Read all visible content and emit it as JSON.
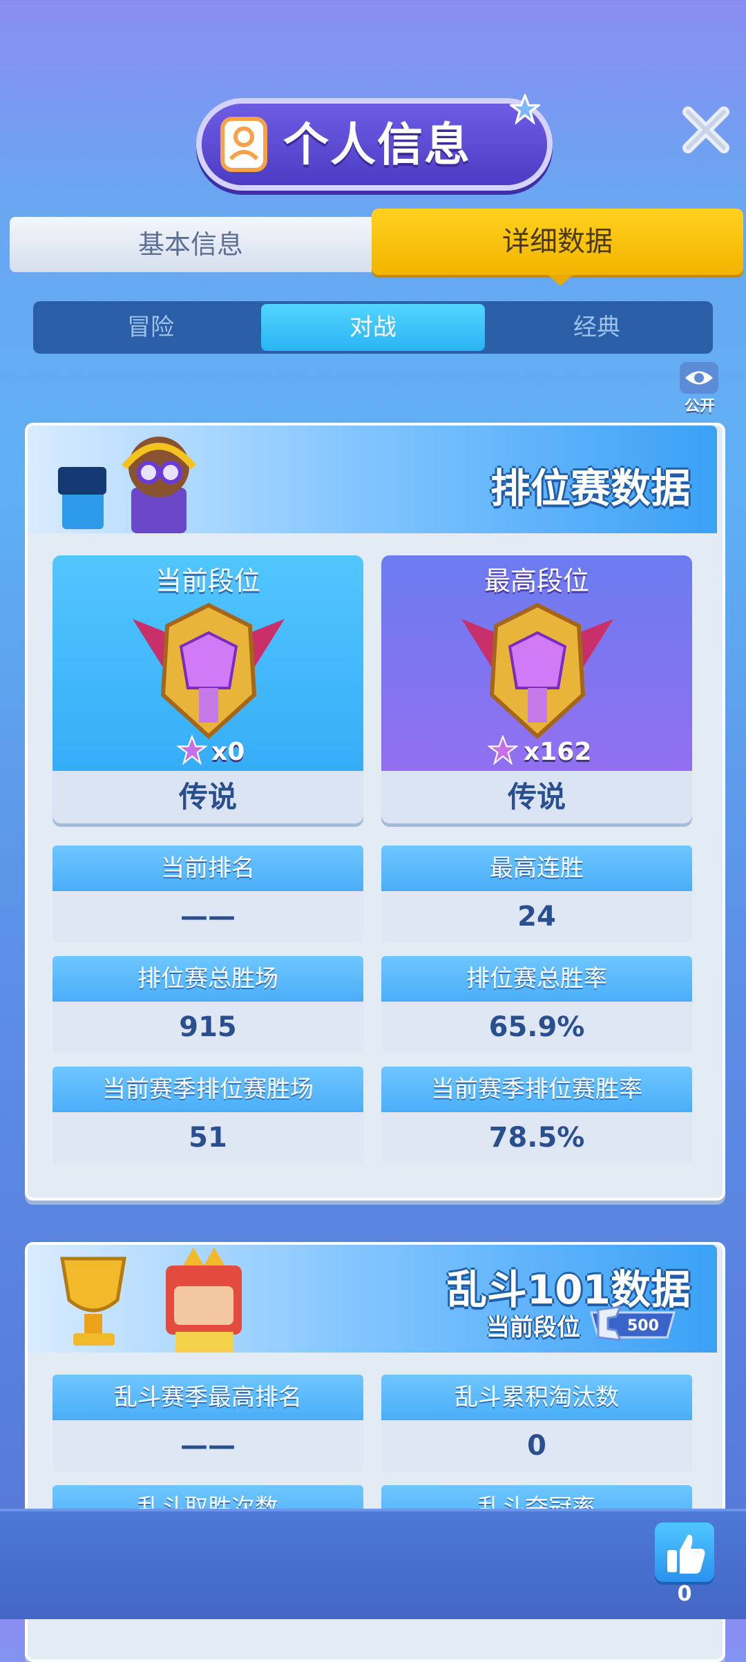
{
  "header": {
    "title": "个人信息"
  },
  "tabs": [
    {
      "label": "基本信息",
      "active": false
    },
    {
      "label": "详细数据",
      "active": true
    }
  ],
  "segments": [
    {
      "label": "冒险",
      "active": false
    },
    {
      "label": "对战",
      "active": true
    },
    {
      "label": "经典",
      "active": false
    }
  ],
  "public_toggle": {
    "label": "公开",
    "icon": "eye-icon"
  },
  "ranked": {
    "title": "排位赛数据",
    "current_tier": {
      "label": "当前段位",
      "stars": "x0",
      "name": "传说"
    },
    "highest_tier": {
      "label": "最高段位",
      "stars": "x162",
      "name": "传说"
    },
    "stats": [
      {
        "label": "当前排名",
        "value": "——"
      },
      {
        "label": "最高连胜",
        "value": "24"
      },
      {
        "label": "排位赛总胜场",
        "value": "915"
      },
      {
        "label": "排位赛总胜率",
        "value": "65.9%"
      },
      {
        "label": "当前赛季排位赛胜场",
        "value": "51"
      },
      {
        "label": "当前赛季排位赛胜率",
        "value": "78.5%"
      }
    ]
  },
  "brawl": {
    "title": "乱斗101数据",
    "current_tier_label": "当前段位",
    "tier_badge_value": "500",
    "stats": [
      {
        "label": "乱斗赛季最高排名",
        "value": "——"
      },
      {
        "label": "乱斗累积淘汰数",
        "value": "0"
      },
      {
        "label": "乱斗取胜次数",
        "value": ""
      },
      {
        "label": "乱斗夺冠率",
        "value": ""
      }
    ]
  },
  "likes": {
    "count": "0",
    "icon": "thumbs-up-icon"
  },
  "colors": {
    "accent_yellow": "#f2b400",
    "accent_blue": "#28b4f3",
    "panel_bg": "#e3ebf5"
  }
}
